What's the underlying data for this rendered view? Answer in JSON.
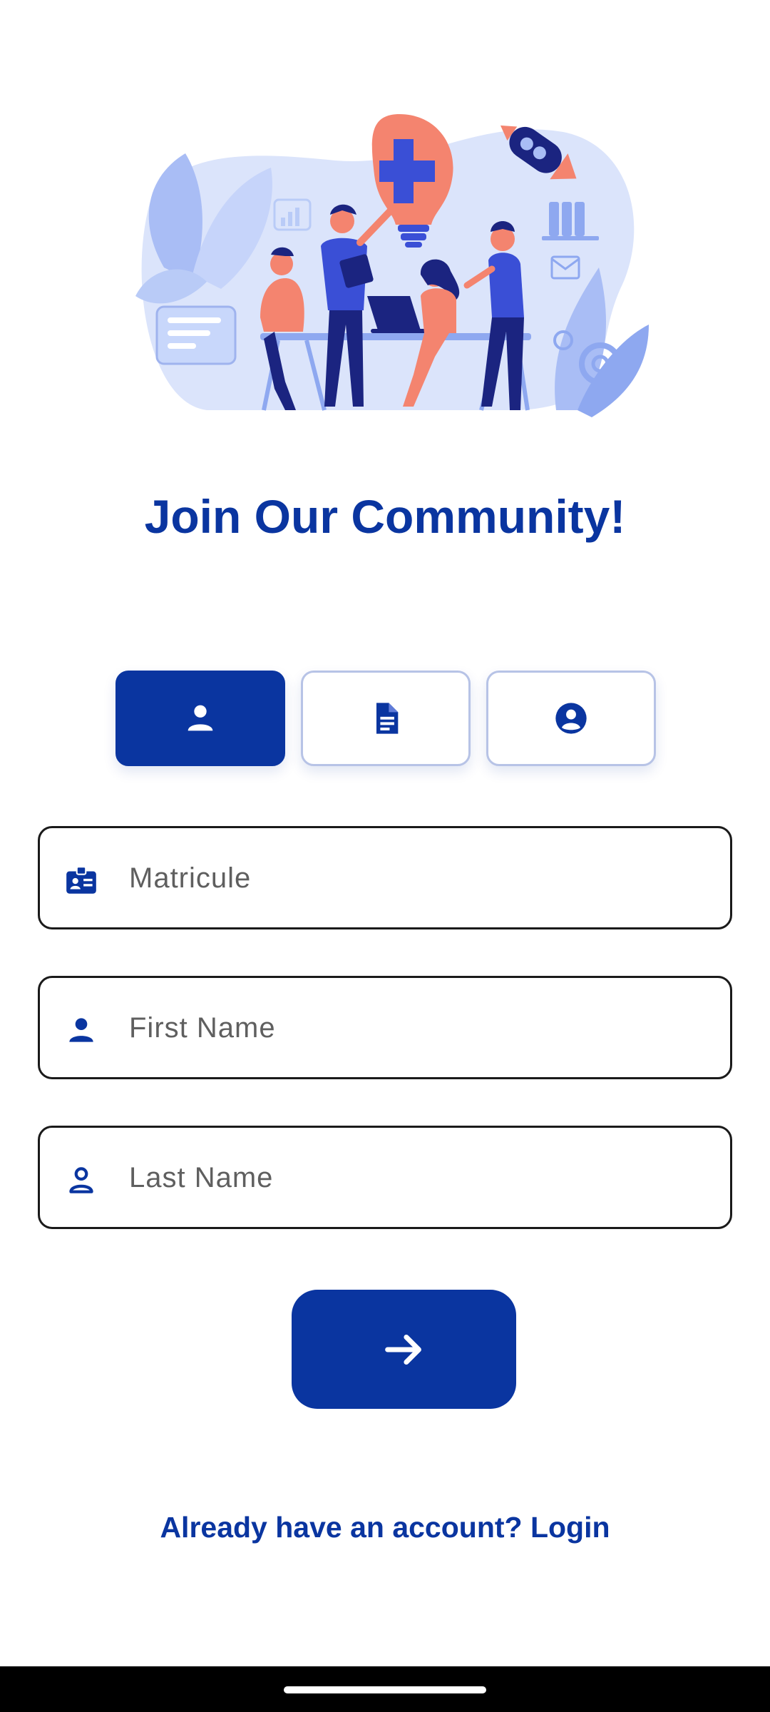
{
  "header": {
    "title": "Join Our Community!"
  },
  "steps": [
    {
      "icon": "person-icon",
      "active": true
    },
    {
      "icon": "document-icon",
      "active": false
    },
    {
      "icon": "account-circle-icon",
      "active": false
    }
  ],
  "form": {
    "matricule": {
      "placeholder": "Matricule",
      "value": "",
      "icon": "id-badge-icon"
    },
    "first_name": {
      "placeholder": "First Name",
      "value": "",
      "icon": "person-icon"
    },
    "last_name": {
      "placeholder": "Last Name",
      "value": "",
      "icon": "person-outline-icon"
    }
  },
  "next_button": {
    "icon": "arrow-right-icon"
  },
  "footer": {
    "login_text": "Already have an account? Login"
  },
  "colors": {
    "primary": "#0a35a0",
    "accent": "#f4846f",
    "light_blue": "#dbe4fb",
    "border_inactive": "#b7c3e6"
  }
}
